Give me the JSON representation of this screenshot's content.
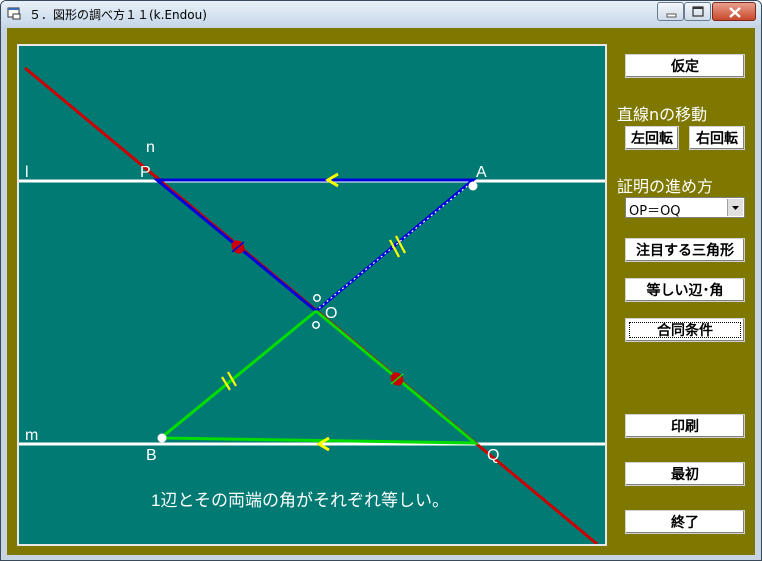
{
  "window": {
    "title": "５．図形の調べ方１１(k.Endou)"
  },
  "canvas": {
    "labels": {
      "line_l": "l",
      "line_m": "m",
      "line_n": "n",
      "point_P": "P",
      "point_A": "A",
      "point_O": "O",
      "point_B": "B",
      "point_Q": "Q"
    },
    "message": "1辺とその両端の角がそれぞれ等しい。"
  },
  "panel": {
    "assumption_button": "仮定",
    "rotate_heading": "直線nの移動",
    "rotate_left_button": "左回転",
    "rotate_right_button": "右回転",
    "proof_heading": "証明の進め方",
    "proof_select_value": "OP＝OQ",
    "focus_triangle_button": "注目する三角形",
    "equal_parts_button": "等しい辺･角",
    "congruence_button": "合同条件",
    "print_button": "印刷",
    "first_button": "最初",
    "exit_button": "終了"
  },
  "colors": {
    "board": "#007a73",
    "frame": "#7e7800",
    "line_white": "#ffffff",
    "line_red": "#cc0000",
    "triangle_blue": "#0000dd",
    "triangle_green": "#00dd00",
    "mark_yellow": "#ffff00"
  }
}
